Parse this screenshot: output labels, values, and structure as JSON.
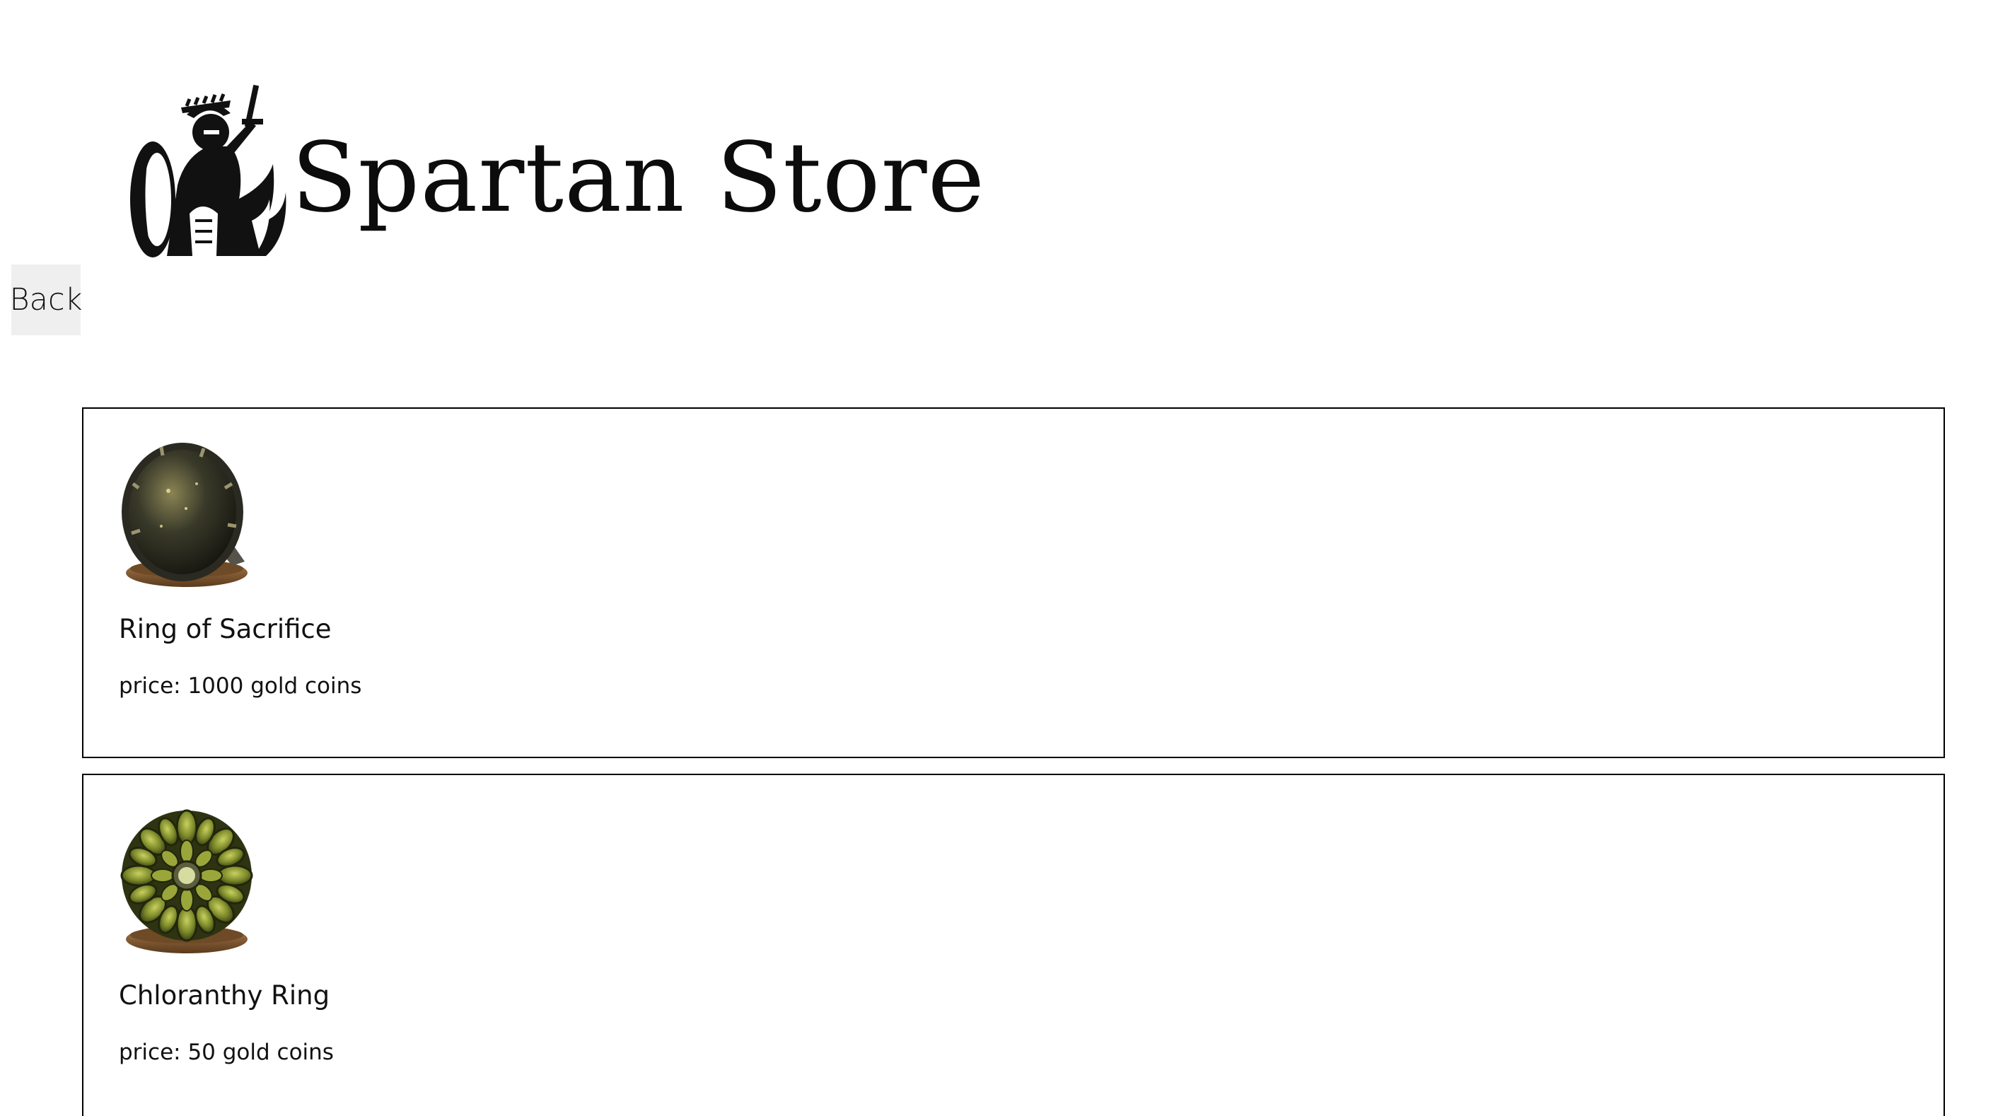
{
  "header": {
    "logo_text": "Spartan Store",
    "logo_icon": "spartan-warrior-icon"
  },
  "navigation": {
    "back_label": "Back"
  },
  "products": [
    {
      "name": "Ring of Sacrifice",
      "price_text": "price: 1000 gold coins",
      "image": "ring-of-sacrifice-image"
    },
    {
      "name": "Chloranthy Ring",
      "price_text": "price: 50 gold coins",
      "image": "chloranthy-ring-image"
    }
  ],
  "colors": {
    "background": "#ffffff",
    "text": "#111111",
    "card_border": "#000000",
    "back_button_bg": "#efefef",
    "sacrifice_stone": "#3a3a2a",
    "chloranthy_gem": "#7d8a2a",
    "ring_band": "#8a6238"
  }
}
